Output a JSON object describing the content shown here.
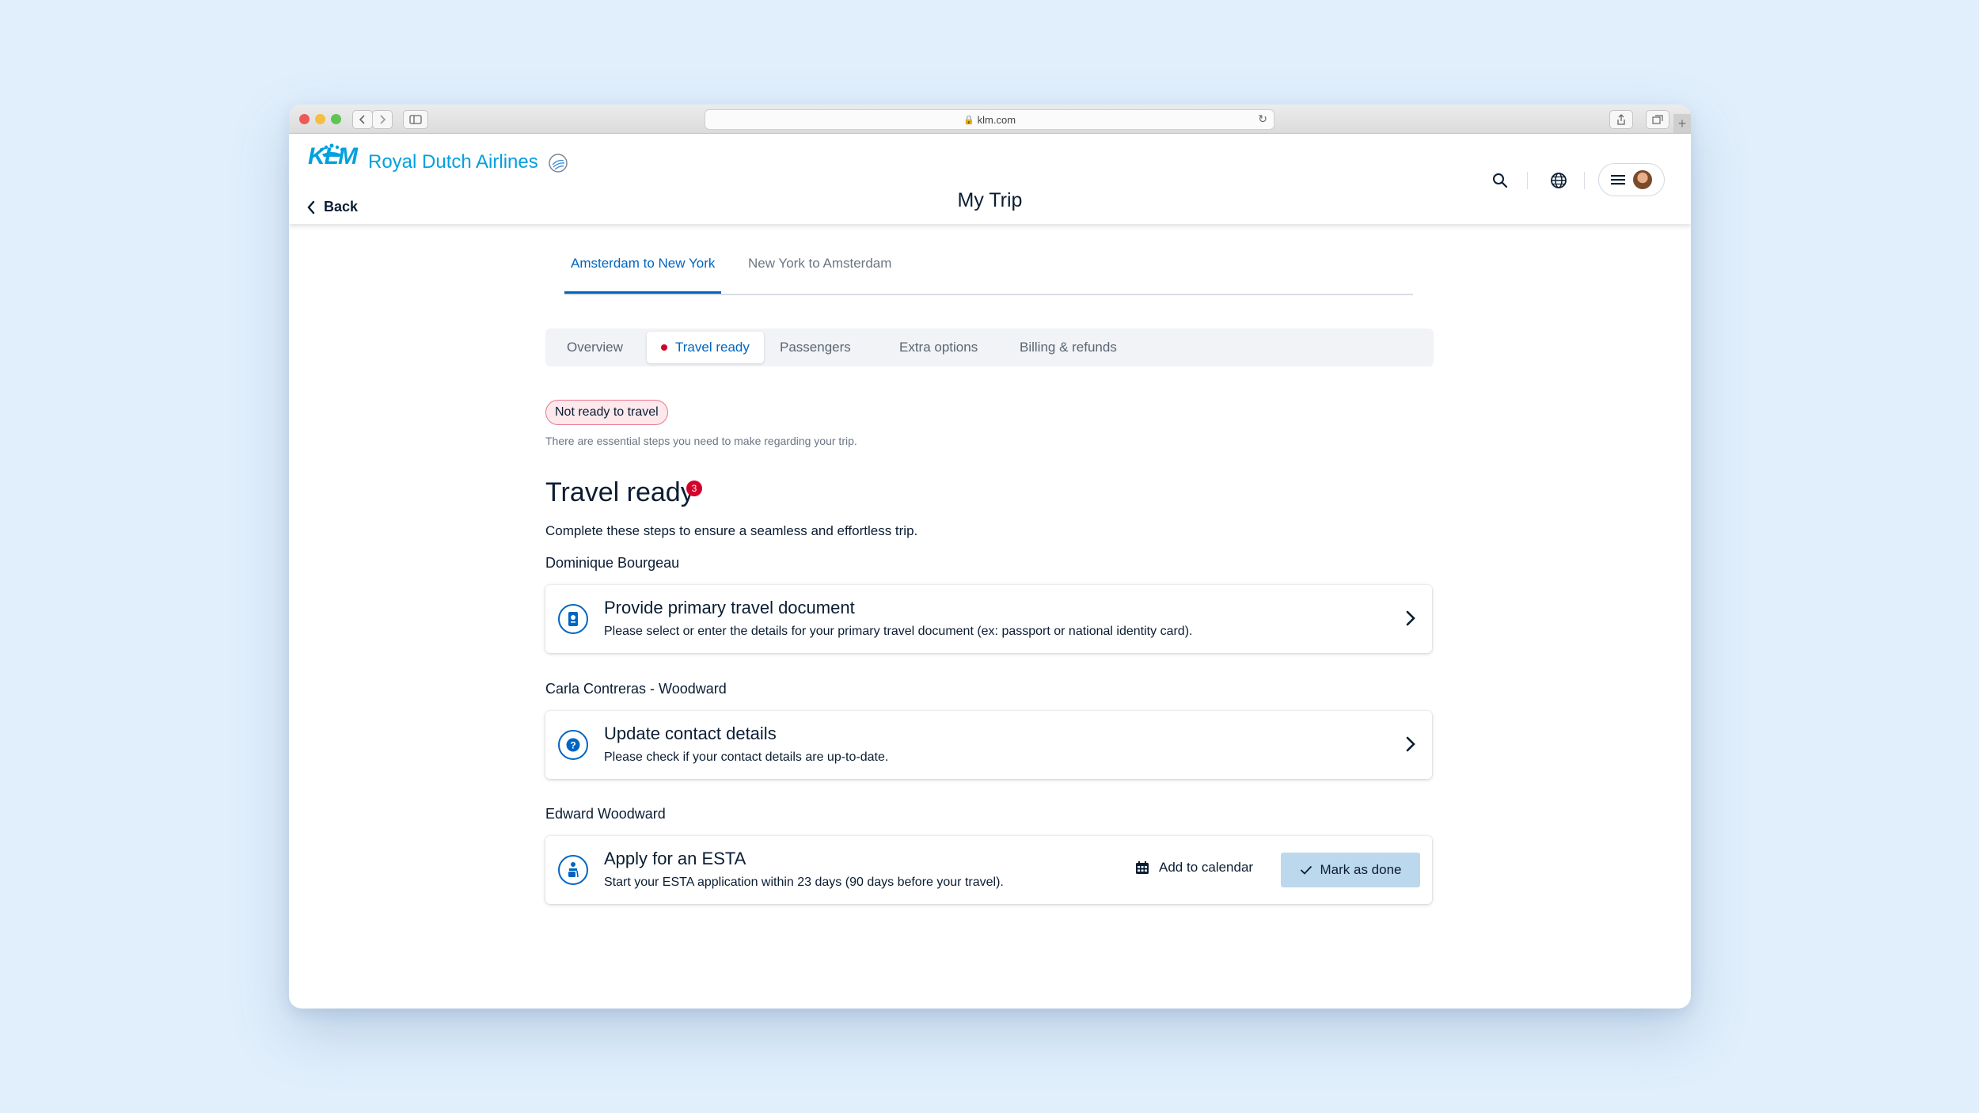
{
  "browser": {
    "url": "klm.com"
  },
  "header": {
    "logo_text": "KLM",
    "brand_name": "Royal Dutch Airlines",
    "back_label": "Back",
    "page_title": "My Trip"
  },
  "route_tabs": [
    {
      "label": "Amsterdam to New York",
      "active": true
    },
    {
      "label": "New York to Amsterdam",
      "active": false
    }
  ],
  "sub_tabs": [
    {
      "label": "Overview"
    },
    {
      "label": "Travel ready",
      "active": true
    },
    {
      "label": "Passengers"
    },
    {
      "label": "Extra options"
    },
    {
      "label": "Billing & refunds"
    }
  ],
  "status": {
    "badge": "Not ready to travel",
    "description": "There are essential steps you need to make regarding your trip."
  },
  "section": {
    "title": "Travel ready",
    "count": "3",
    "description": "Complete these steps to ensure a seamless and effortless trip."
  },
  "passengers": [
    {
      "name": "Dominique Bourgeau",
      "task": {
        "icon": "passport-icon",
        "title": "Provide primary travel document",
        "description": "Please select or enter the details for your primary travel document (ex: passport or national identity card)."
      }
    },
    {
      "name": "Carla Contreras - Woodward",
      "task": {
        "icon": "question-icon",
        "title": "Update contact details",
        "description": "Please check if your contact details are up-to-date."
      }
    },
    {
      "name": "Edward Woodward",
      "task": {
        "icon": "traveler-icon",
        "title": "Apply for an ESTA",
        "description": "Start your ESTA application within 23 days (90 days before your travel).",
        "calendar_label": "Add to calendar",
        "done_label": "Mark as done"
      }
    }
  ],
  "colors": {
    "brand": "#00a1de",
    "accent": "#0065c2",
    "alert": "#d5002b",
    "done_button": "#bcd8ec"
  }
}
